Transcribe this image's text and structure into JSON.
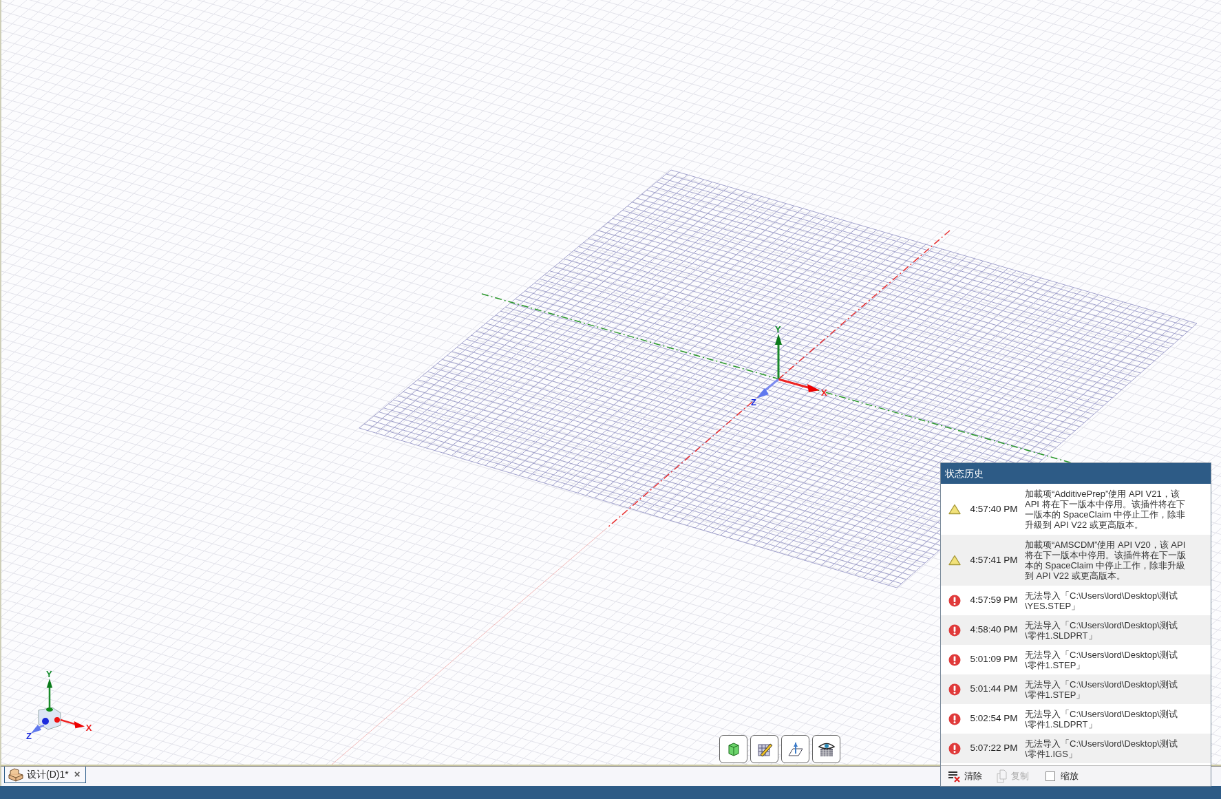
{
  "viewport": {
    "main_triad": {
      "labels": [
        "Y",
        "X",
        "Z"
      ]
    },
    "corner_triad": {
      "labels": [
        "Y",
        "X",
        "Z"
      ]
    },
    "toolbar": [
      {
        "kind": "solid"
      },
      {
        "kind": "sketch"
      },
      {
        "kind": "section"
      },
      {
        "kind": "view"
      }
    ]
  },
  "document_tabs": [
    {
      "label": "设计(D)1*",
      "selected": true,
      "close": "×"
    }
  ],
  "status_history": {
    "title": "状态历史",
    "entries": [
      {
        "kind": "warning",
        "time": "4:57:40 PM",
        "message": "加載项“AdditivePrep”使用 API V21，该 API 将在下一版本中停用。该插件将在下一版本的 SpaceClaim 中停止工作，除非升級到 API V22 或更高版本。"
      },
      {
        "kind": "warning",
        "time": "4:57:41 PM",
        "message": "加載项“AMSCDM”使用 API V20，该 API 将在下一版本中停用。该插件将在下一版本的 SpaceClaim 中停止工作，除非升級到 API V22 或更高版本。"
      },
      {
        "kind": "error",
        "time": "4:57:59 PM",
        "message": "无法导入「C:\\Users\\lord\\Desktop\\测试\\YES.STEP」"
      },
      {
        "kind": "error",
        "time": "4:58:40 PM",
        "message": "无法导入「C:\\Users\\lord\\Desktop\\测试\\零件1.SLDPRT」"
      },
      {
        "kind": "error",
        "time": "5:01:09 PM",
        "message": "无法导入「C:\\Users\\lord\\Desktop\\测试\\零件1.STEP」"
      },
      {
        "kind": "error",
        "time": "5:01:44 PM",
        "message": "无法导入「C:\\Users\\lord\\Desktop\\测试\\零件1.STEP」"
      },
      {
        "kind": "error",
        "time": "5:02:54 PM",
        "message": "无法导入「C:\\Users\\lord\\Desktop\\测试\\零件1.SLDPRT」"
      },
      {
        "kind": "error",
        "time": "5:07:22 PM",
        "message": "无法导入「C:\\Users\\lord\\Desktop\\测试\\零件1.IGS」"
      }
    ],
    "actions": [
      {
        "kind": "button",
        "label": "清除",
        "disabled": false
      },
      {
        "kind": "button",
        "label": "复制",
        "disabled": true
      },
      {
        "kind": "checkbox",
        "label": "缩放",
        "checked": false
      }
    ]
  }
}
